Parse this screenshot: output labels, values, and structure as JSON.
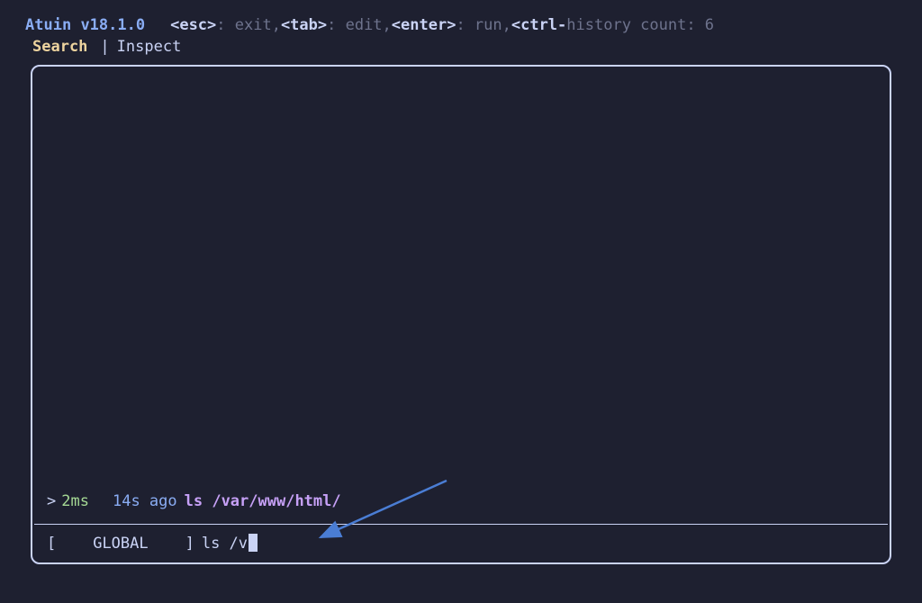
{
  "header": {
    "app_name": "Atuin",
    "version": "v18.1.0",
    "keys": {
      "esc": "<esc>",
      "esc_desc": ": exit, ",
      "tab": "<tab>",
      "tab_desc": ": edit, ",
      "enter": "<enter>",
      "enter_desc": ": run, ",
      "ctrl": "<ctrl-",
      "status": "history count: 6"
    }
  },
  "tabs": {
    "active": "Search",
    "separator": "|",
    "inactive": "Inspect"
  },
  "result": {
    "marker": ">",
    "duration": "2ms",
    "time_ago": "14s ago",
    "command": "ls /var/www/html/"
  },
  "search": {
    "scope_open": "[",
    "scope": "GLOBAL",
    "scope_close": "]",
    "query": "ls /v"
  }
}
